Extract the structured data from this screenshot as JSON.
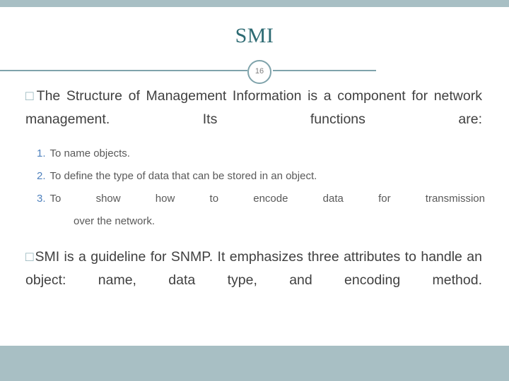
{
  "slide": {
    "title": "SMI",
    "number": "16",
    "bullets": [
      {
        "marker": "□",
        "text": "The Structure of Management Information is a component for network management. Its functions are:"
      },
      {
        "marker": "□",
        "text": "SMI is a guideline for SNMP. It emphasizes three attributes to handle an object: name, data type, and encoding method."
      }
    ],
    "sub_items": [
      {
        "num": "1.",
        "text": "To name objects."
      },
      {
        "num": "2.",
        "text": "To define the type of data that can be stored in an  object."
      },
      {
        "num": "3.",
        "text": "To show how to encode data for transmission",
        "text2": "over the network."
      }
    ]
  },
  "colors": {
    "band": "#a8bfc4",
    "title": "#2e6b73",
    "rule": "#7fa3ab",
    "bullet_marker": "#8fb0b8",
    "sub_number": "#4f81bd",
    "body_text": "#404040",
    "sub_text": "#595959"
  }
}
